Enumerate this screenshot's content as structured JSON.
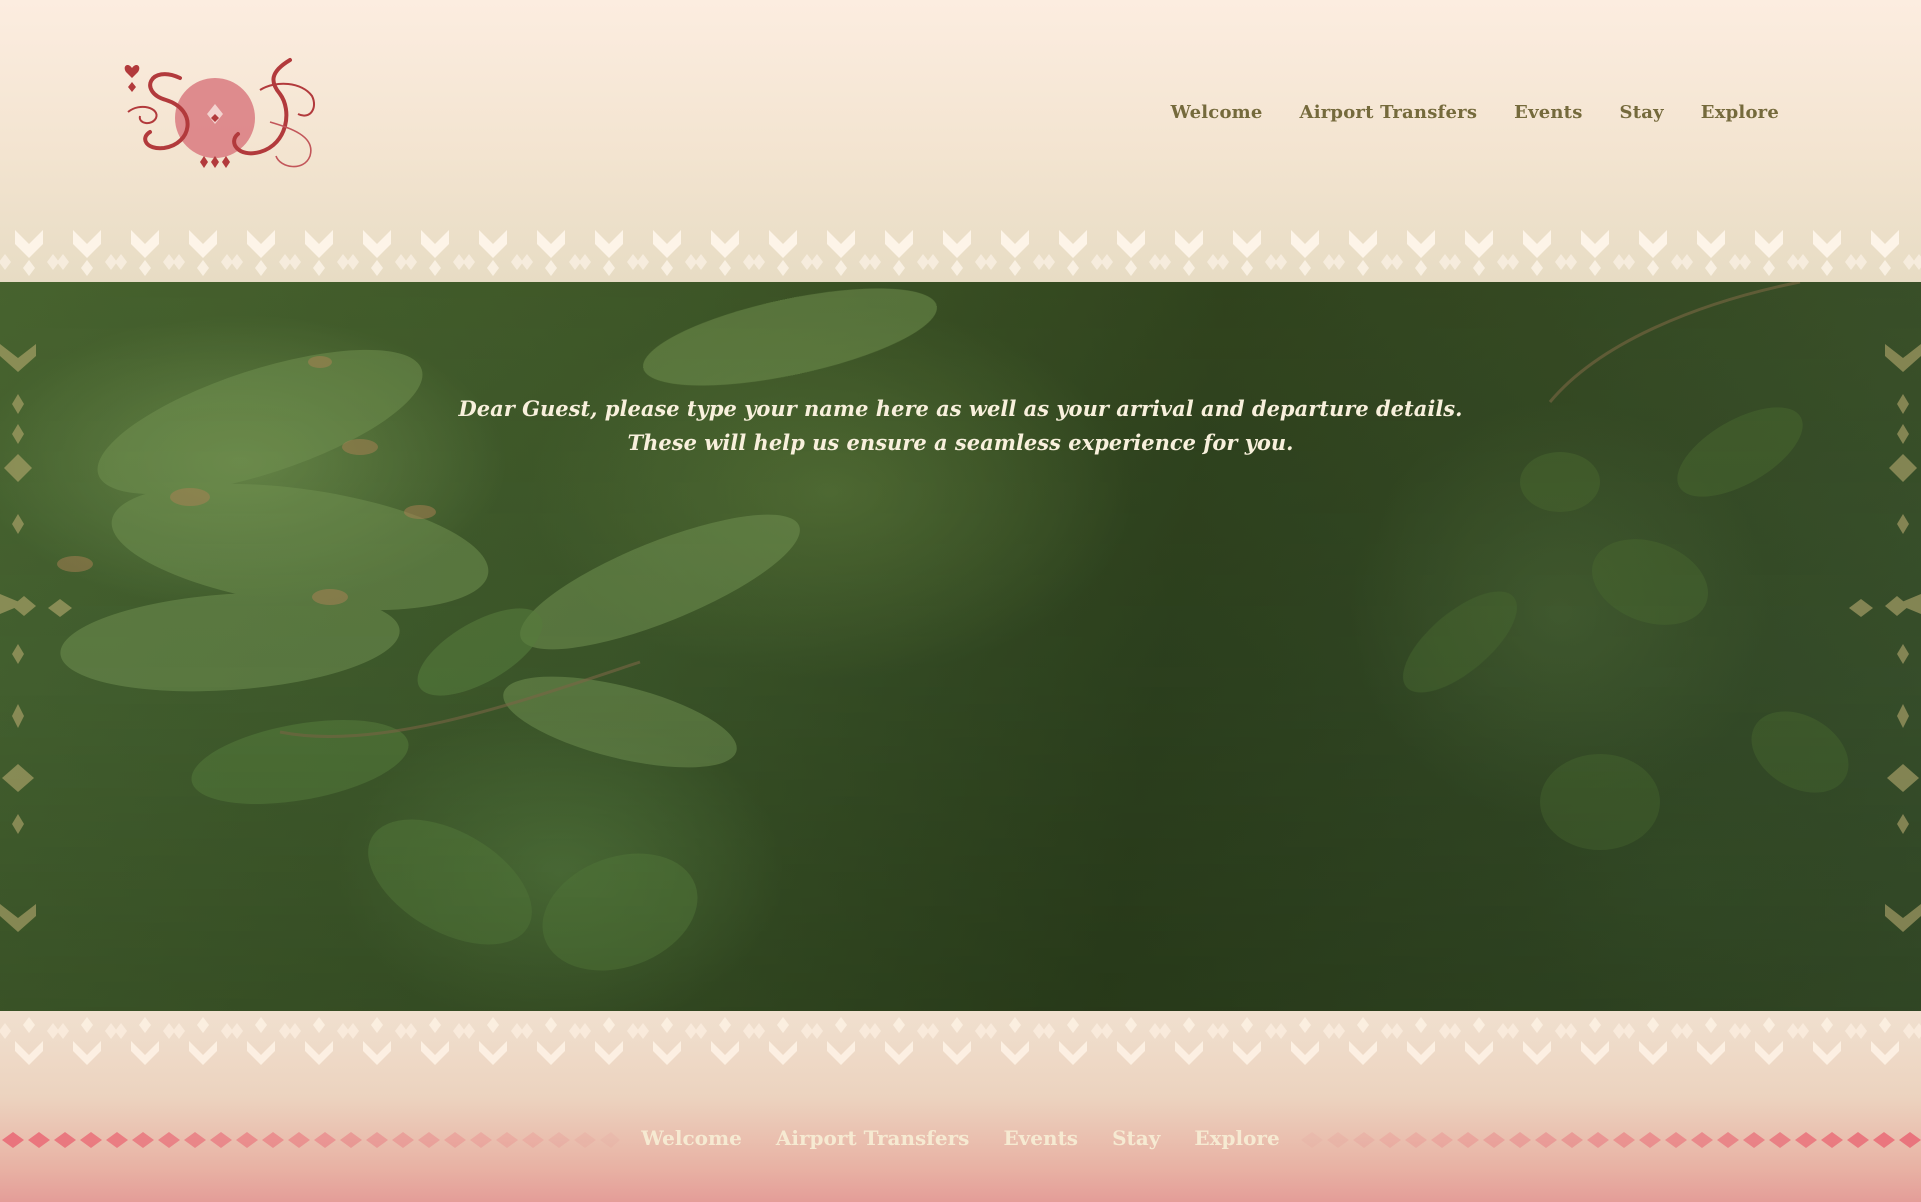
{
  "header": {
    "logo": {
      "monogram": "SJ",
      "icon": "monogram-logo"
    },
    "nav": [
      {
        "label": "Welcome"
      },
      {
        "label": "Airport Transfers"
      },
      {
        "label": "Events"
      },
      {
        "label": "Stay"
      },
      {
        "label": "Explore"
      }
    ]
  },
  "hero": {
    "line1": "Dear Guest, please type your name here as well as your arrival and departure details.",
    "line2": "These will help us ensure a seamless experience for you."
  },
  "footer": {
    "nav": [
      {
        "label": "Welcome"
      },
      {
        "label": "Airport Transfers"
      },
      {
        "label": "Events"
      },
      {
        "label": "Stay"
      },
      {
        "label": "Explore"
      }
    ]
  },
  "colors": {
    "header_bg": "#fcede0",
    "nav_text": "#756a3c",
    "logo_red": "#b23a3c",
    "hero_text": "#f8f0dc",
    "footer_text": "#f6ead2",
    "footer_pink": "#e49d98"
  }
}
